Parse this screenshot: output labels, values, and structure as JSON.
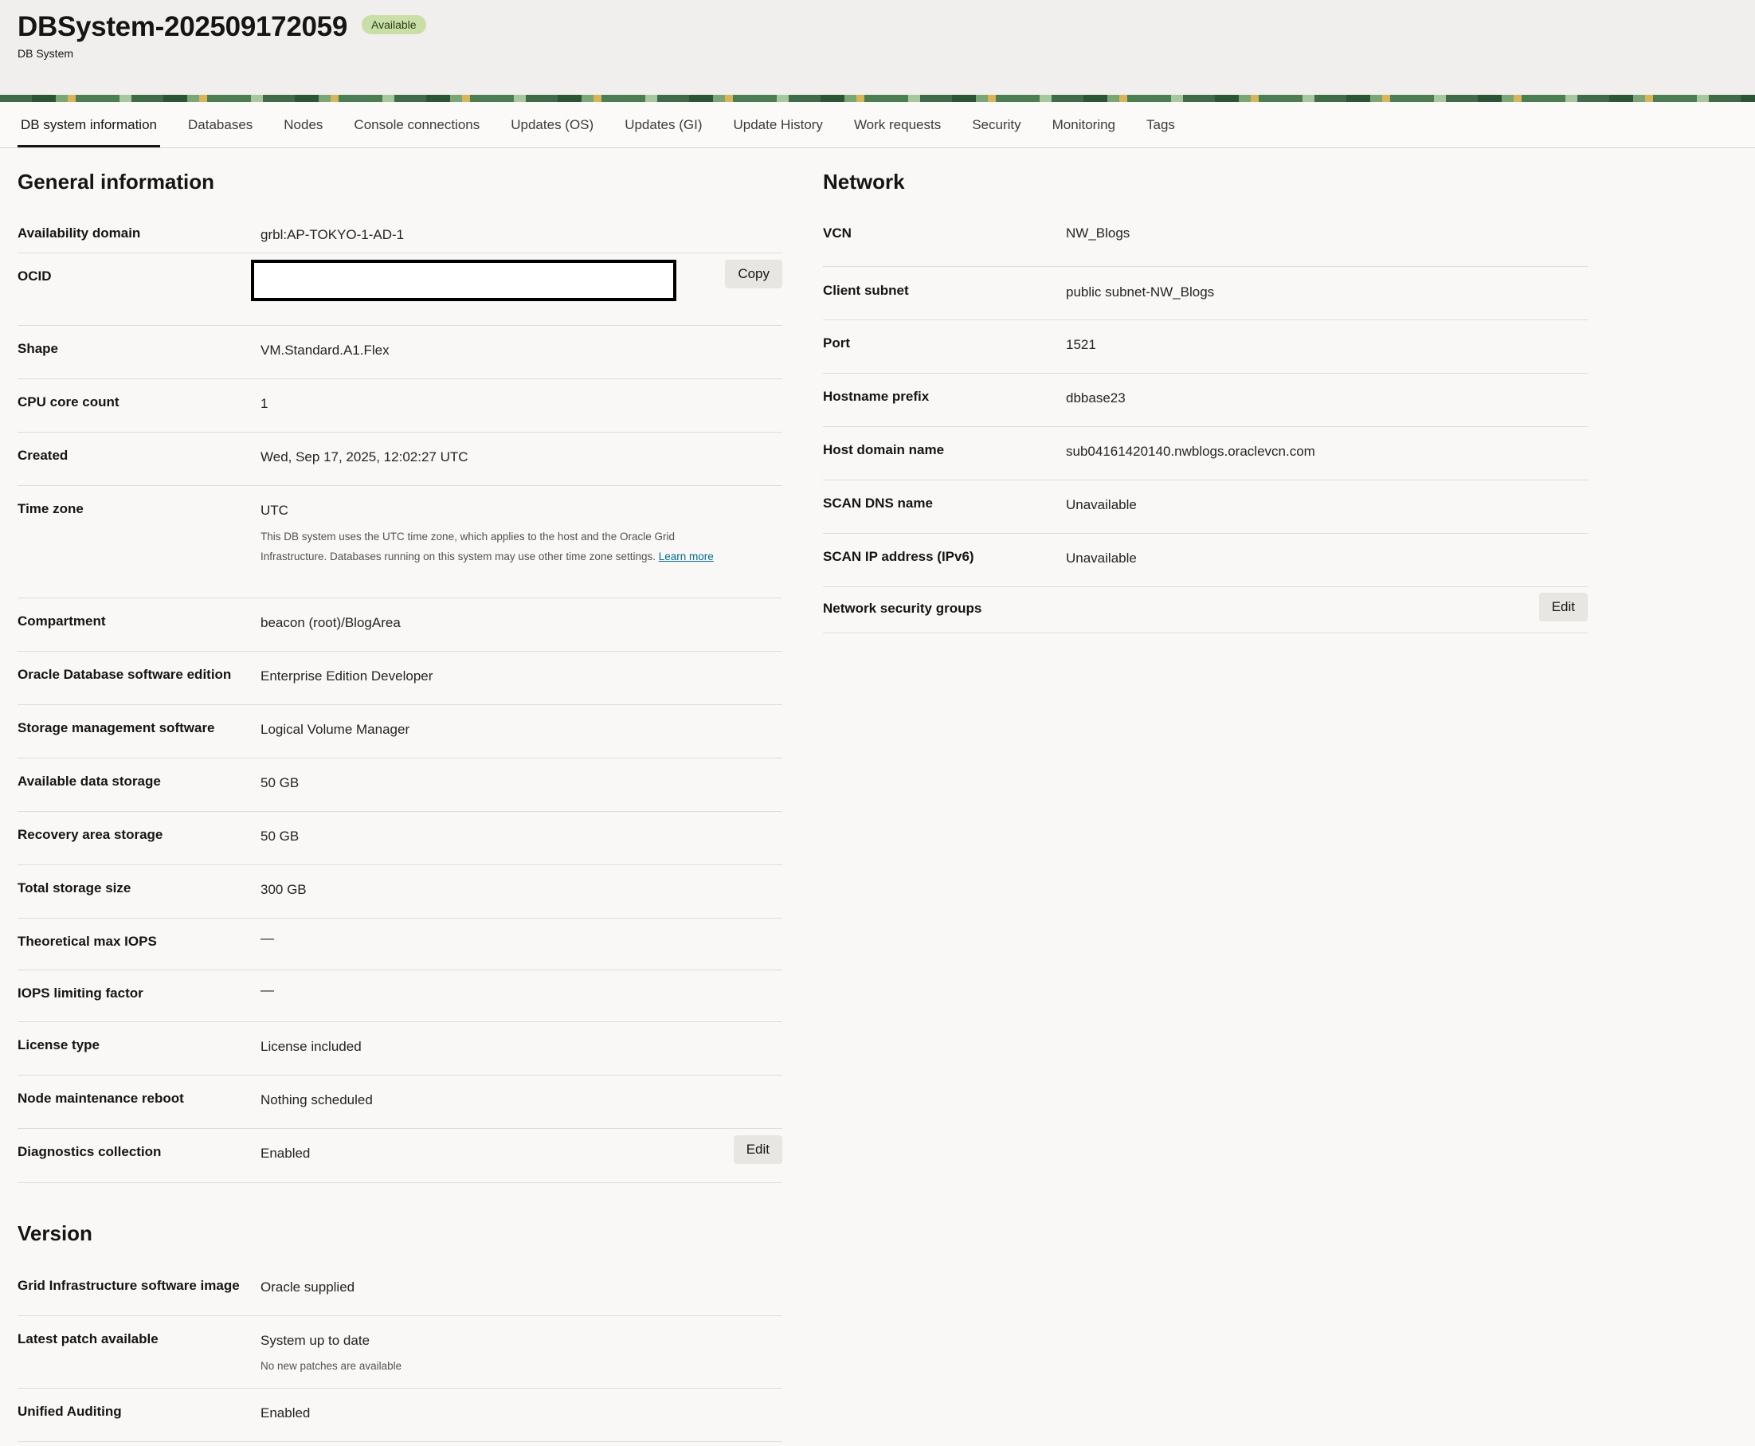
{
  "header": {
    "title": "DBSystem-202509172059",
    "status": "Available",
    "subtitle": "DB System"
  },
  "tabs": [
    {
      "label": "DB system information",
      "active": true
    },
    {
      "label": "Databases"
    },
    {
      "label": "Nodes"
    },
    {
      "label": "Console connections"
    },
    {
      "label": "Updates (OS)"
    },
    {
      "label": "Updates (GI)"
    },
    {
      "label": "Update History"
    },
    {
      "label": "Work requests"
    },
    {
      "label": "Security"
    },
    {
      "label": "Monitoring"
    },
    {
      "label": "Tags"
    }
  ],
  "general": {
    "title": "General information",
    "availability_domain": {
      "label": "Availability domain",
      "value": "grbl:AP-TOKYO-1-AD-1"
    },
    "ocid": {
      "label": "OCID",
      "copy": "Copy"
    },
    "shape": {
      "label": "Shape",
      "value": "VM.Standard.A1.Flex"
    },
    "cpu": {
      "label": "CPU core count",
      "value": "1"
    },
    "created": {
      "label": "Created",
      "value": "Wed, Sep 17, 2025, 12:02:27 UTC"
    },
    "timezone": {
      "label": "Time zone",
      "value": "UTC",
      "help": "This DB system uses the UTC time zone, which applies to the host and the Oracle Grid Infrastructure. Databases running on this system may use other time zone settings.",
      "learn_more": "Learn more"
    },
    "compartment": {
      "label": "Compartment",
      "value": "beacon (root)/BlogArea"
    },
    "edition": {
      "label": "Oracle Database software edition",
      "value": "Enterprise Edition Developer"
    },
    "storage_mgmt": {
      "label": "Storage management software",
      "value": "Logical Volume Manager"
    },
    "data_storage": {
      "label": "Available data storage",
      "value": "50 GB"
    },
    "recovery_storage": {
      "label": "Recovery area storage",
      "value": "50 GB"
    },
    "total_storage": {
      "label": "Total storage size",
      "value": "300 GB"
    },
    "max_iops": {
      "label": "Theoretical max IOPS",
      "value": "—"
    },
    "iops_factor": {
      "label": "IOPS limiting factor",
      "value": "—"
    },
    "license": {
      "label": "License type",
      "value": "License included"
    },
    "maintenance": {
      "label": "Node maintenance reboot",
      "value": "Nothing scheduled"
    },
    "diagnostics": {
      "label": "Diagnostics collection",
      "value": "Enabled",
      "edit": "Edit"
    }
  },
  "version": {
    "title": "Version",
    "gi_image": {
      "label": "Grid Infrastructure software image",
      "value": "Oracle supplied"
    },
    "latest_patch": {
      "label": "Latest patch available",
      "value": "System up to date",
      "help": "No new patches are available"
    },
    "auditing": {
      "label": "Unified Auditing",
      "value": "Enabled"
    }
  },
  "network": {
    "title": "Network",
    "vcn": {
      "label": "VCN",
      "value": "NW_Blogs"
    },
    "subnet": {
      "label": "Client subnet",
      "value": "public subnet-NW_Blogs"
    },
    "port": {
      "label": "Port",
      "value": "1521"
    },
    "hostname": {
      "label": "Hostname prefix",
      "value": "dbbase23"
    },
    "domain": {
      "label": "Host domain name",
      "value": "sub04161420140.nwblogs.oraclevcn.com"
    },
    "scan_dns": {
      "label": "SCAN DNS name",
      "value": "Unavailable"
    },
    "scan_ip": {
      "label": "SCAN IP address (IPv6)",
      "value": "Unavailable"
    },
    "nsg": {
      "label": "Network security groups",
      "edit": "Edit"
    }
  }
}
